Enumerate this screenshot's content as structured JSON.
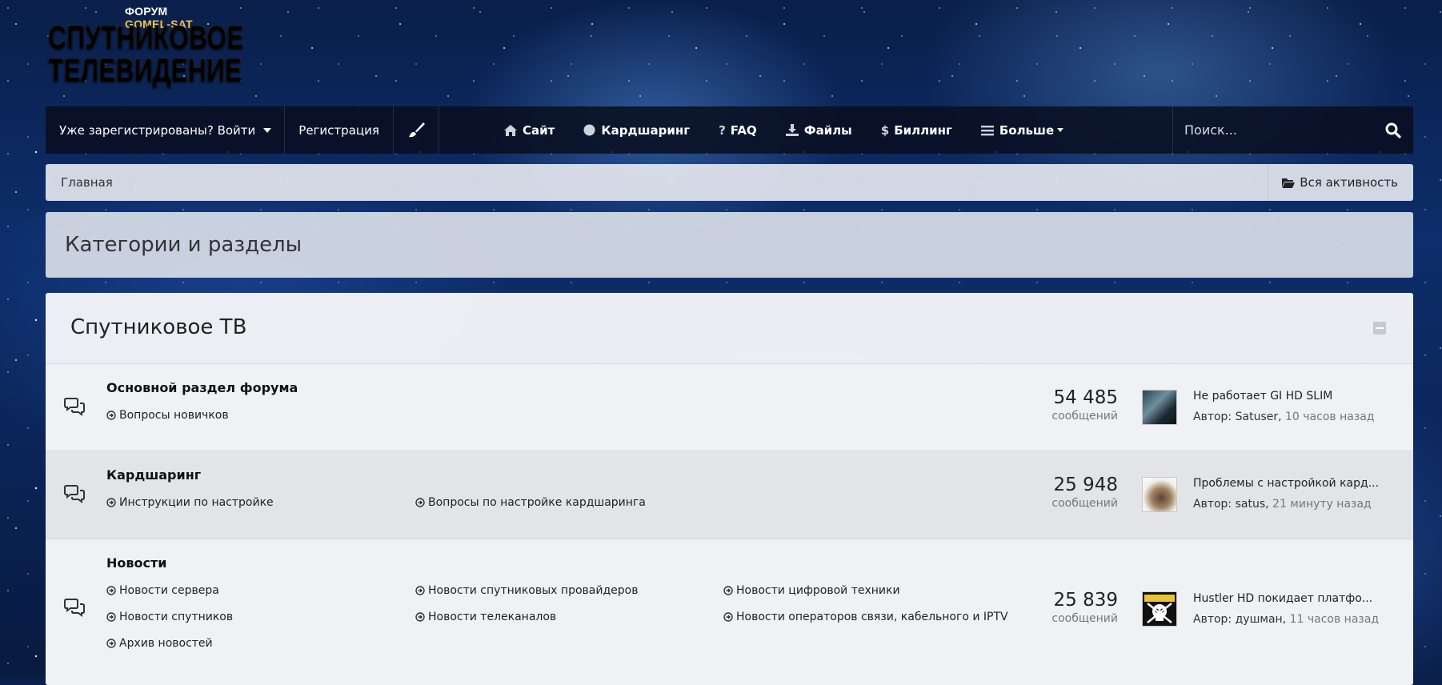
{
  "logo": {
    "top_prefix": "ФОРУМ",
    "top_suffix": "GOMEL-SAT",
    "line1": "СПУТНИКОВОЕ",
    "line2": "ТЕЛЕВИДЕНИЕ"
  },
  "nav": {
    "login_label": "Уже зарегистрированы? Войти",
    "register_label": "Регистрация",
    "theme_icon": "paintbrush-icon",
    "items": [
      {
        "label": "Сайт",
        "icon": "home-icon"
      },
      {
        "label": "Кардшаринг",
        "icon": "circle-icon"
      },
      {
        "label": "FAQ",
        "icon": "question-icon"
      },
      {
        "label": "Файлы",
        "icon": "download-icon"
      },
      {
        "label": "Биллинг",
        "icon": "dollar-icon"
      },
      {
        "label": "Больше",
        "icon": "bars-icon"
      }
    ],
    "search_placeholder": "Поиск...",
    "search_icon": "search-icon"
  },
  "breadcrumb": {
    "home": "Главная",
    "activity": "Вся активность"
  },
  "page_title": "Категории и разделы",
  "category": {
    "title": "Спутниковое ТВ",
    "forums": [
      {
        "title": "Основной раздел форума",
        "subforums": [
          "Вопросы новичков"
        ],
        "count": "54 485",
        "count_label": "сообщений",
        "last_post": {
          "title": "Не работает GI HD SLIM",
          "author_prefix": "Автор:",
          "author": "Satuser",
          "time": "10 часов назад"
        }
      },
      {
        "title": "Кардшаринг",
        "subforums": [
          "Инструкции по настройке",
          "Вопросы по настройке кардшаринга"
        ],
        "count": "25 948",
        "count_label": "сообщений",
        "last_post": {
          "title": "Проблемы с настройкой кард...",
          "author_prefix": "Автор:",
          "author": "satus",
          "time": "21 минуту назад"
        }
      },
      {
        "title": "Новости",
        "subforums": [
          "Новости сервера",
          "Новости спутниковых провайдеров",
          "Новости цифровой техники",
          "Новости спутников",
          "Новости телеканалов",
          "Новости операторов связи, кабельного и IPTV",
          "Архив новостей"
        ],
        "count": "25 839",
        "count_label": "сообщений",
        "last_post": {
          "title": "Hustler HD покидает платфо...",
          "author_prefix": "Автор:",
          "author": "душман",
          "time": "11 часов назад"
        }
      }
    ]
  },
  "colors": {
    "navbar_bg": "#080e1e",
    "logo_gold": "#f4c873",
    "panel_bg": "#eef0f5"
  }
}
